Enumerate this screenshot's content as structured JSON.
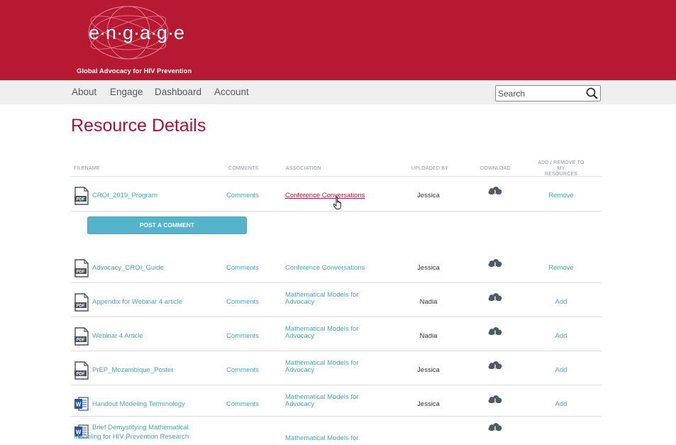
{
  "brand": {
    "logo_word": "engage",
    "tagline": "Global Advocacy for HIV Prevention",
    "header_color": "#b71832",
    "accent_color": "#a3153a",
    "link_color": "#4fa2bb",
    "button_color": "#55b3cc"
  },
  "nav": {
    "items": [
      "About",
      "Engage",
      "Dashboard",
      "Account"
    ]
  },
  "search": {
    "placeholder": "Search",
    "icon": "search-icon"
  },
  "page": {
    "title": "Resource Details"
  },
  "table": {
    "headers": {
      "filename": "FILENAME",
      "comments": "COMMENTS",
      "association": "ASSOCIATION",
      "uploaded_by": "UPLOADED BY",
      "download": "DOWNLOAD",
      "add_remove_1": "ADD / REMOVE TO MY",
      "add_remove_2": "RESOURCES"
    },
    "post_comment_label": "POST A COMMENT",
    "rows": [
      {
        "name": "CROI_2019_Program",
        "type": "pdf",
        "comments": "Comments",
        "assoc": "Conference Conversations",
        "assoc2": "",
        "by": "Jessica",
        "action": "Remove"
      },
      {
        "name": "Advocacy_CROI_Guide",
        "type": "pdf",
        "comments": "Comments",
        "assoc": "Conference Conversations",
        "assoc2": "",
        "by": "Jessica",
        "action": "Remove"
      },
      {
        "name": "Appendix for Webinar 4 article",
        "type": "pdf",
        "comments": "Comments",
        "assoc": "Mathematical Models for",
        "assoc2": "Advocacy",
        "by": "Nadia",
        "action": "Add"
      },
      {
        "name": "Webinar 4 Article",
        "type": "pdf",
        "comments": "Comments",
        "assoc": "Mathematical Models for",
        "assoc2": "Advocacy",
        "by": "Nadia",
        "action": "Add"
      },
      {
        "name": "PrEP_Mozambique_Poster",
        "type": "pdf",
        "comments": "Comments",
        "assoc": "Mathematical Models for",
        "assoc2": "Advocacy",
        "by": "Jessica",
        "action": "Add"
      },
      {
        "name": "Handout Modeling Terminology",
        "type": "word",
        "comments": "Comments",
        "assoc": "Mathematical Models for",
        "assoc2": "Advocacy",
        "by": "Jessica",
        "action": "Add"
      },
      {
        "name": "Brief Demystifying Mathematical",
        "name2": "Modeling for HIV Prevention Research",
        "type": "word",
        "comments": "",
        "assoc": "Mathematical Models for",
        "assoc2": "",
        "by": "",
        "action": ""
      }
    ]
  }
}
